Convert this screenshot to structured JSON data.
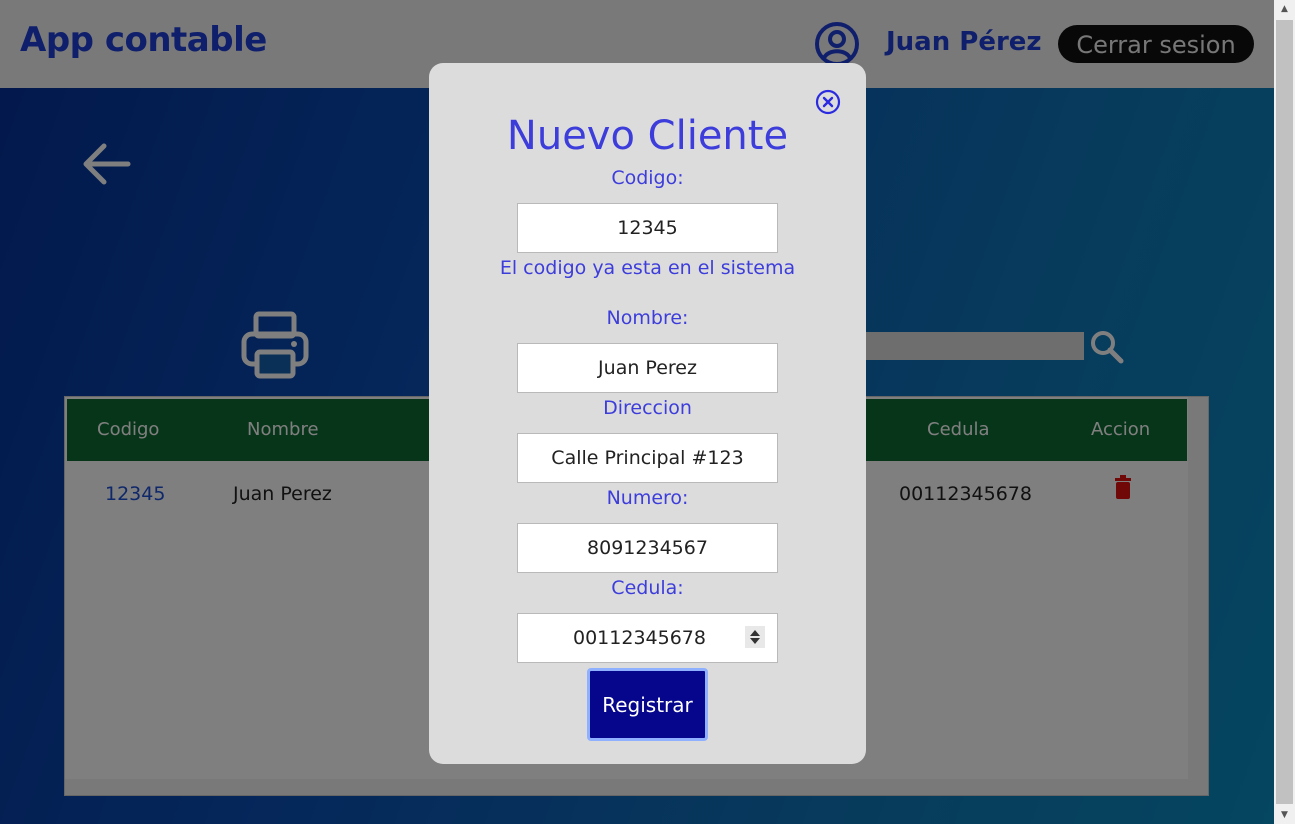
{
  "header": {
    "app_title": "App contable",
    "user_name": "Juan Pérez",
    "logout_label": "Cerrar sesion"
  },
  "table": {
    "columns": [
      "Codigo",
      "Nombre",
      "Cedula",
      "Accion"
    ],
    "rows": [
      {
        "codigo": "12345",
        "nombre": "Juan Perez",
        "cedula": "00112345678"
      }
    ]
  },
  "modal": {
    "title": "Nuevo Cliente",
    "codigo_label": "Codigo:",
    "codigo_value": "12345",
    "codigo_error": "El codigo ya esta en el sistema",
    "nombre_label": "Nombre:",
    "nombre_value": "Juan Perez",
    "direccion_label": "Direccion",
    "direccion_value": "Calle Principal #123",
    "numero_label": "Numero:",
    "numero_value": "8091234567",
    "cedula_label": "Cedula:",
    "cedula_value": "00112345678",
    "submit_label": "Registrar"
  },
  "colors": {
    "accent": "#3d3ddb",
    "submit_bg": "#06068c",
    "table_header": "#0f6b32",
    "delete_icon": "#e01010"
  },
  "icons": [
    "user-circle-icon",
    "back-arrow-icon",
    "printer-icon",
    "search-icon",
    "trash-icon",
    "close-circle-icon"
  ]
}
